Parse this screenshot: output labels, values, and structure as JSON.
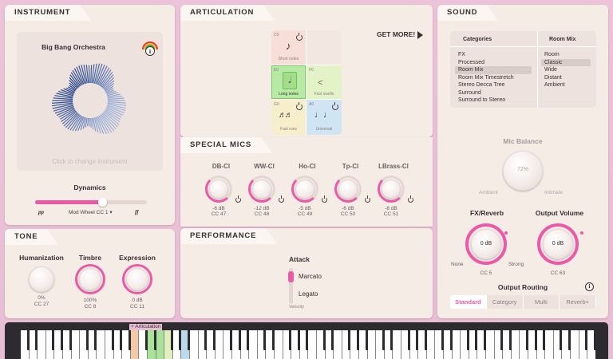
{
  "instrument": {
    "tab": "INSTRUMENT",
    "name": "Big Bang Orchestra",
    "change_hint": "Click to change instrument",
    "dynamics_label": "Dynamics",
    "dyn_min": "pp",
    "dyn_max": "ff",
    "dyn_cc": "Mod Wheel  CC 1",
    "dynamics_value": 0.6
  },
  "tone": {
    "tab": "TONE",
    "knobs": [
      {
        "label": "Humanization",
        "value": "0%",
        "cc": "CC 27"
      },
      {
        "label": "Timbre",
        "value": "100%",
        "cc": "CC 8"
      },
      {
        "label": "Expression",
        "value": "0 dB",
        "cc": "CC 11"
      }
    ]
  },
  "articulation": {
    "tab": "ARTICULATION",
    "get_more": "GET MORE!",
    "cells": [
      {
        "note": "C0",
        "label": "Short notes",
        "color": "#f7dfd8"
      },
      {
        "note": "",
        "label": "",
        "color": "#f3e7e1"
      },
      {
        "note": "E0",
        "label": "Long notes",
        "color": "#b8e9a5"
      },
      {
        "note": "F0",
        "label": "Fast swells",
        "color": "#e4f2c8"
      },
      {
        "note": "G0",
        "label": "Fast runs",
        "color": "#f7eecc"
      },
      {
        "note": "A0",
        "label": "Universal",
        "color": "#cfe5f4"
      }
    ]
  },
  "mics": {
    "tab": "SPECIAL MICS",
    "items": [
      {
        "label": "DB-Cl",
        "value": "-6 dB",
        "cc": "CC 47"
      },
      {
        "label": "WW-Cl",
        "value": "-12 dB",
        "cc": "CC 48"
      },
      {
        "label": "Ho-Cl",
        "value": "-5 dB",
        "cc": "CC 49"
      },
      {
        "label": "Tp-Cl",
        "value": "-6 dB",
        "cc": "CC 50"
      },
      {
        "label": "LBrass-Cl",
        "value": "-8 dB",
        "cc": "CC 51"
      }
    ]
  },
  "performance": {
    "tab": "PERFORMANCE",
    "attack_label": "Attack",
    "opt1": "Marcato",
    "opt2": "Legato",
    "velocity": "Velocity"
  },
  "sound": {
    "tab": "SOUND",
    "cat_header": "Categories",
    "room_header": "Room Mix",
    "categories": [
      "FX",
      "Processed",
      "Room Mix",
      "Room Mix Timestretch",
      "Stereo Decca Tree",
      "Surround",
      "Surround to Stereo"
    ],
    "rooms": [
      "Room",
      "Classic",
      "Wide",
      "Distant",
      "Ambient"
    ],
    "mic_balance": "Mic Balance",
    "mic_value": "72%",
    "ambient": "Ambient",
    "intimate": "Intimate",
    "fx_label": "FX/Reverb",
    "fx_value": "0 dB",
    "fx_cc": "CC 5",
    "none": "None",
    "strong": "Strong",
    "out_label": "Output Volume",
    "out_value": "0 dB",
    "out_cc": "CC 63",
    "routing": "Output Routing",
    "routes": [
      "Standard",
      "Category",
      "Multi",
      "Reverb+"
    ]
  },
  "keyboard": {
    "label": "+ Articulation"
  },
  "colors": {
    "accent": "#ea5aa9",
    "panel": "#f5ece6"
  }
}
